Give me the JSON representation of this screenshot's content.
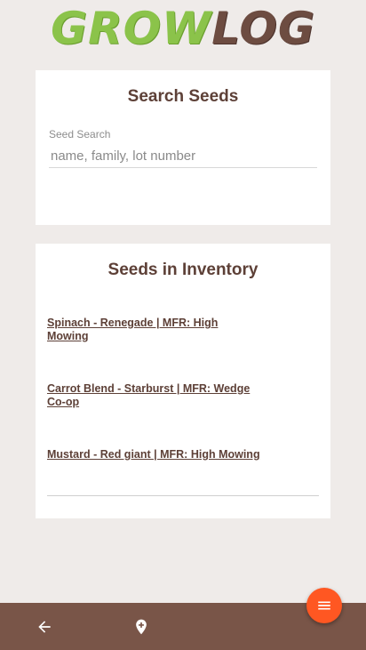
{
  "app": {
    "logo_part1": "GROW",
    "logo_part2": "LOG"
  },
  "search_card": {
    "title": "Search Seeds",
    "field_label": "Seed Search",
    "placeholder": "name, family, lot number",
    "value": ""
  },
  "inventory_card": {
    "title": "Seeds in Inventory",
    "items": [
      {
        "label": "Spinach - Renegade | MFR: High Mowing"
      },
      {
        "label": "Carrot Blend - Starburst | MFR: Wedge Co-op"
      },
      {
        "label": "Mustard - Red giant | MFR: High Mowing"
      }
    ]
  },
  "bottom_nav": {
    "back_icon": "arrow-back-icon",
    "location_icon": "add-location-icon",
    "menu_icon": "menu-icon"
  },
  "colors": {
    "brand_brown": "#795548",
    "title_brown": "#5d4037",
    "logo_green": "#8bc34a",
    "fab_orange": "#ff5722",
    "background": "#efebe9"
  }
}
